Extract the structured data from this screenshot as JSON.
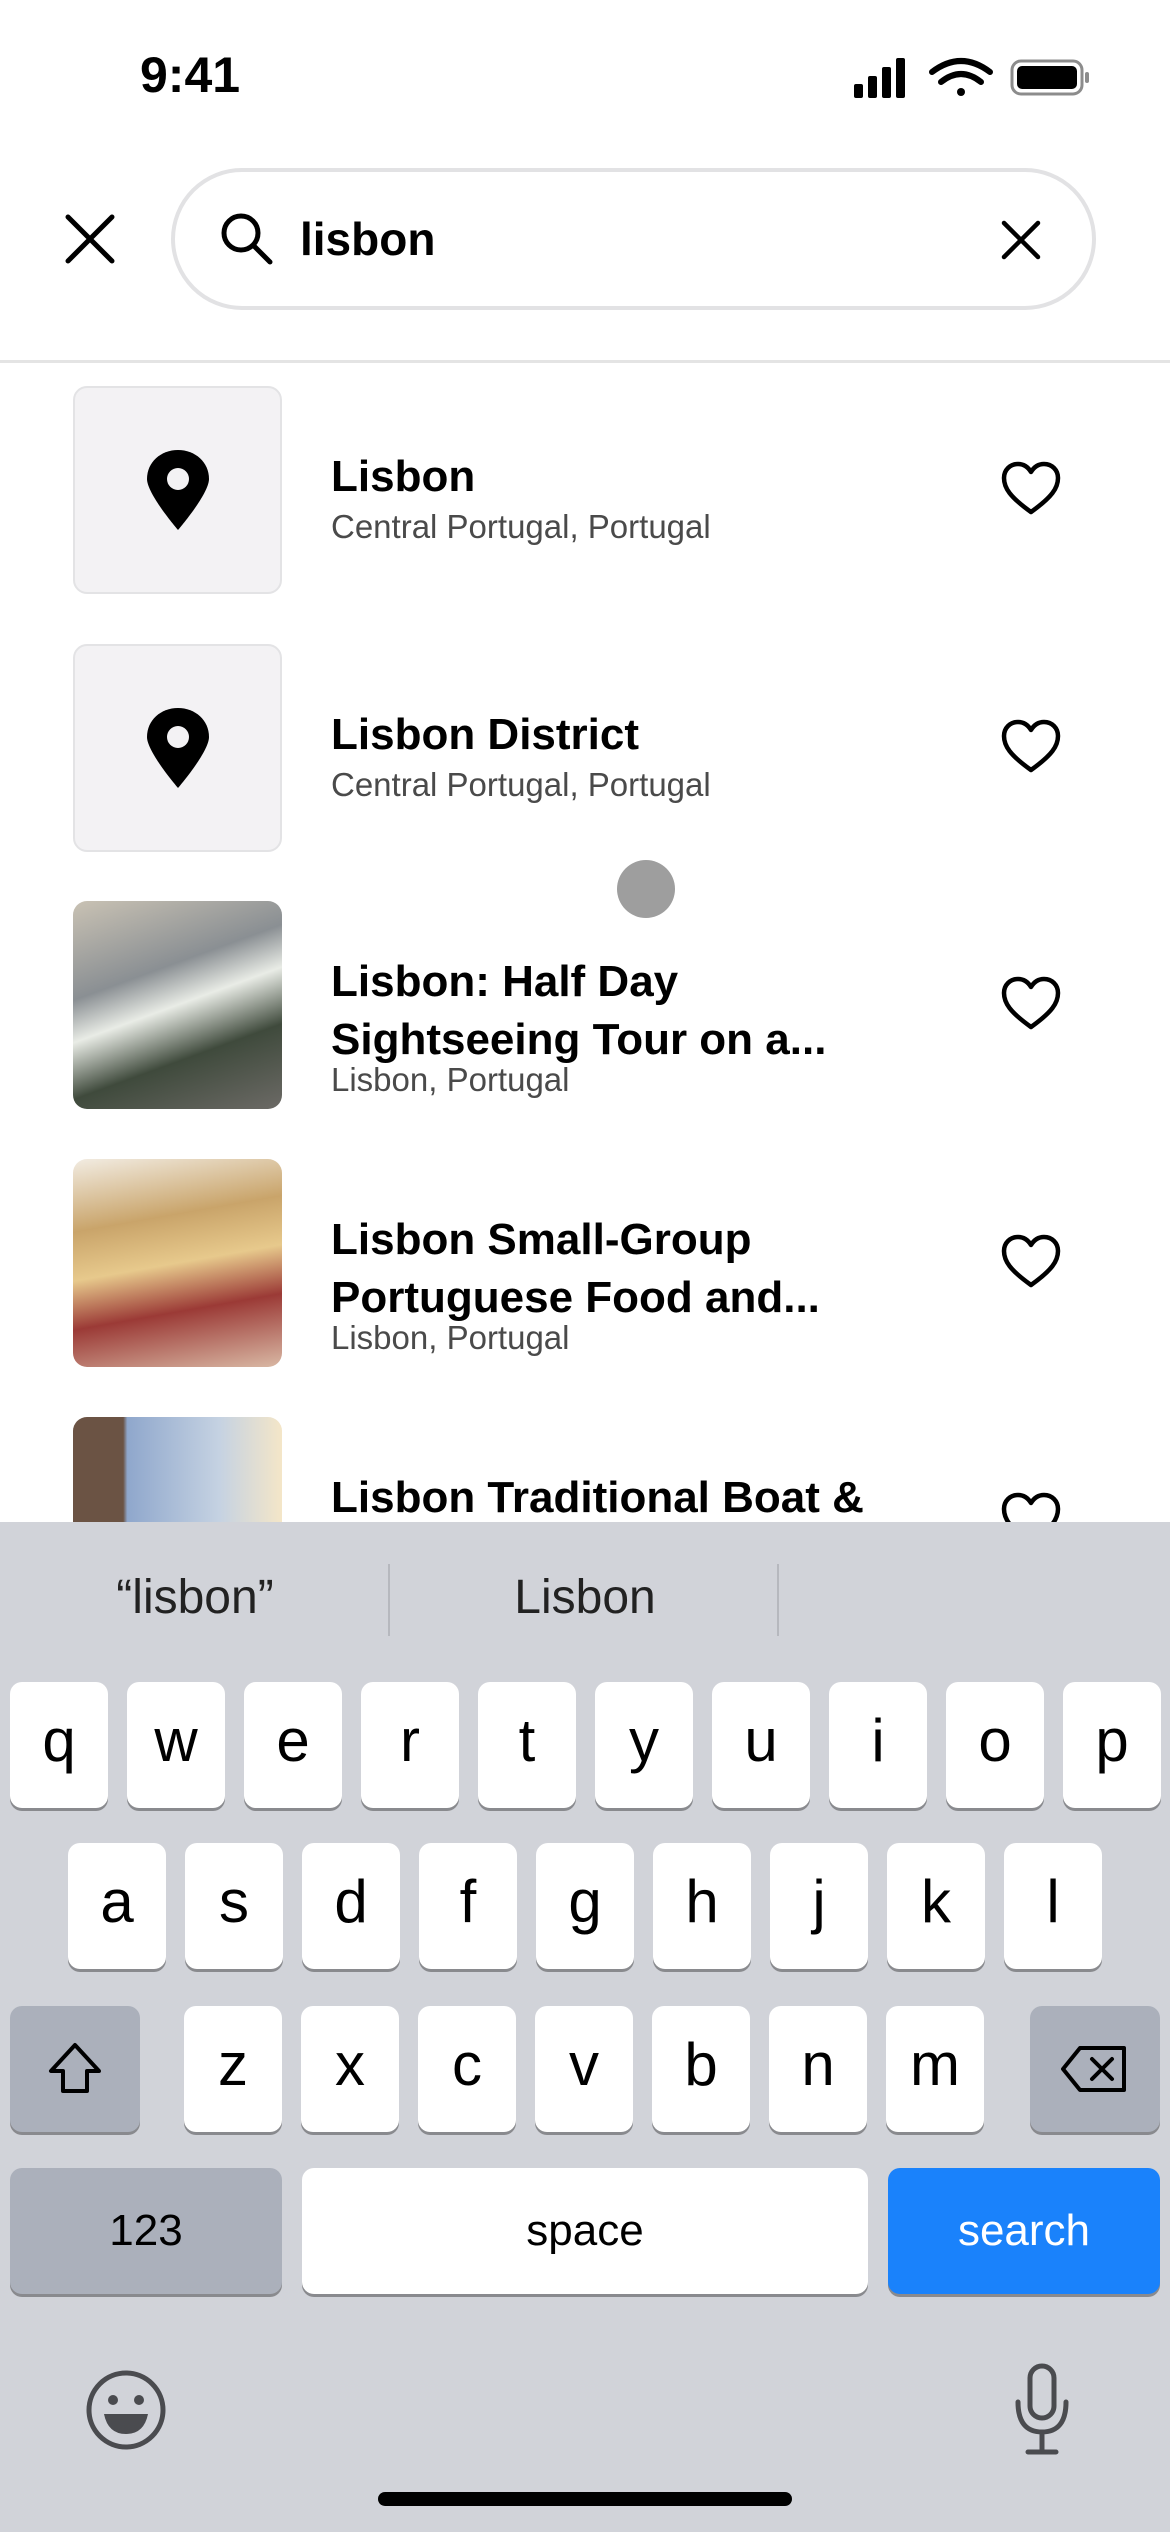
{
  "status_bar": {
    "time": "9:41",
    "icons": [
      "signal-icon",
      "wifi-icon",
      "battery-icon"
    ]
  },
  "search": {
    "query": "lisbon",
    "close_icon": "close-icon",
    "search_icon": "search-icon",
    "clear_icon": "clear-icon"
  },
  "results": [
    {
      "title": "Lisbon",
      "subtitle": "Central Portugal, Portugal",
      "type": "location"
    },
    {
      "title": "Lisbon District",
      "subtitle": "Central Portugal, Portugal",
      "type": "location"
    },
    {
      "title": "Lisbon: Half Day Sightseeing Tour on a...",
      "subtitle": "Lisbon, Portugal",
      "type": "photo"
    },
    {
      "title": "Lisbon Small-Group Portuguese Food and...",
      "subtitle": "Lisbon, Portugal",
      "type": "photo"
    },
    {
      "title": "Lisbon Traditional Boat & Sunset Cruise",
      "subtitle": "",
      "type": "photo"
    }
  ],
  "keyboard": {
    "suggestions": [
      "“lisbon”",
      "Lisbon"
    ],
    "row1": [
      "q",
      "w",
      "e",
      "r",
      "t",
      "y",
      "u",
      "i",
      "o",
      "p"
    ],
    "row2": [
      "a",
      "s",
      "d",
      "f",
      "g",
      "h",
      "j",
      "k",
      "l"
    ],
    "row3": [
      "z",
      "x",
      "c",
      "v",
      "b",
      "n",
      "m"
    ],
    "numbers": "123",
    "space": "space",
    "search": "search",
    "search_color": "#1a82fb"
  }
}
